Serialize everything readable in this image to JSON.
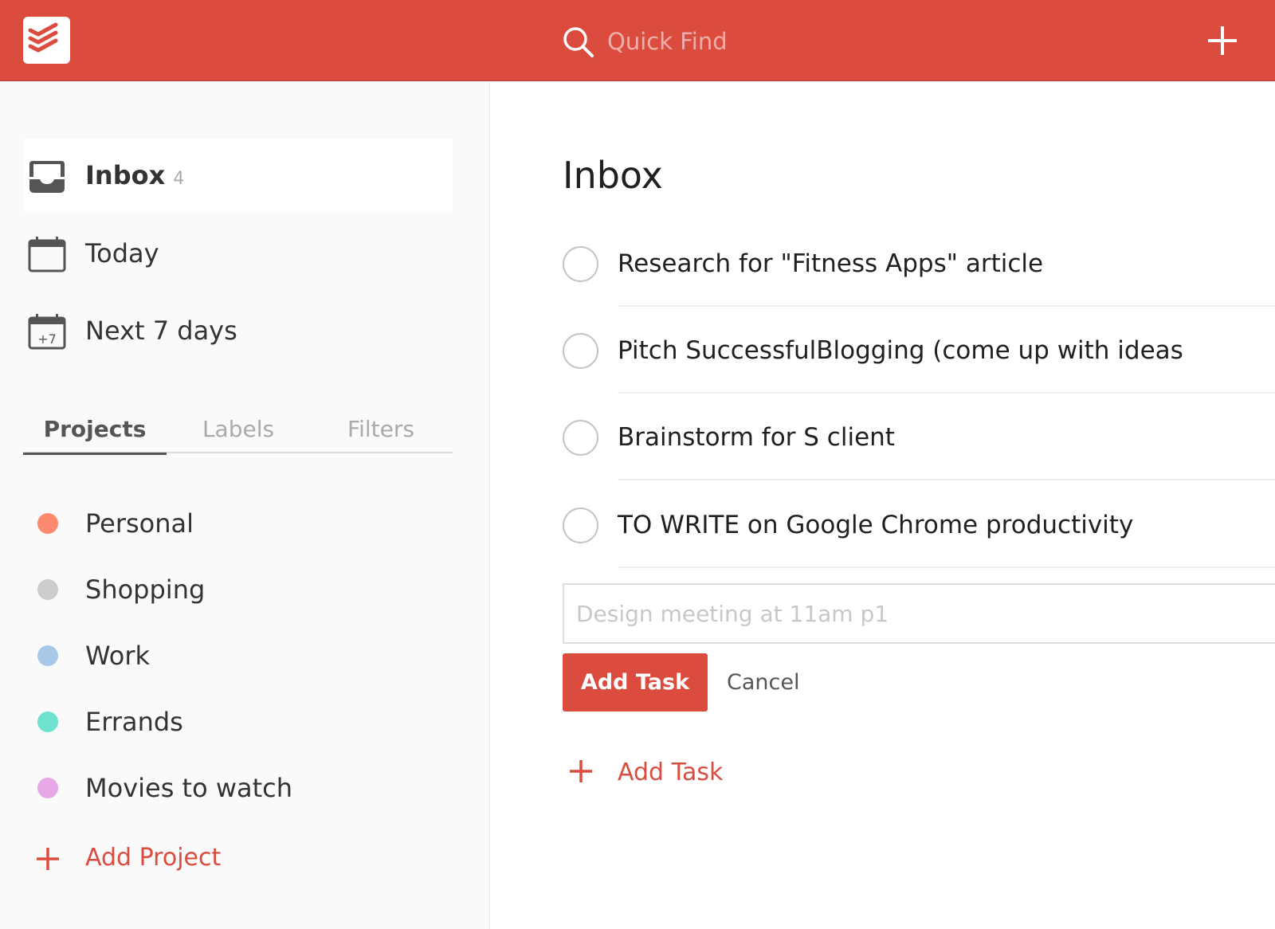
{
  "header": {
    "search_placeholder": "Quick Find",
    "brand_color": "#db4c3f",
    "icons": {
      "logo": "todoist-logo-icon",
      "search": "search-icon",
      "add": "plus-icon"
    }
  },
  "sidebar": {
    "nav": [
      {
        "label": "Inbox",
        "count": "4",
        "icon": "inbox-icon",
        "active": true
      },
      {
        "label": "Today",
        "icon": "calendar-icon"
      },
      {
        "label": "Next 7 days",
        "icon": "calendar-plus7-icon",
        "icon_text": "+7"
      }
    ],
    "tabs": [
      {
        "label": "Projects",
        "active": true
      },
      {
        "label": "Labels"
      },
      {
        "label": "Filters"
      }
    ],
    "projects": [
      {
        "label": "Personal",
        "color": "#fd8a6e"
      },
      {
        "label": "Shopping",
        "color": "#cccccc"
      },
      {
        "label": "Work",
        "color": "#a8c8e8"
      },
      {
        "label": "Errands",
        "color": "#6ee2cf"
      },
      {
        "label": "Movies to watch",
        "color": "#e6a8e6"
      }
    ],
    "add_project_label": "Add Project"
  },
  "main": {
    "title": "Inbox",
    "tasks": [
      {
        "text": "Research for \"Fitness Apps\" article"
      },
      {
        "text": "Pitch SuccessfulBlogging (come up with ideas"
      },
      {
        "text": "Brainstorm for S client"
      },
      {
        "text": "TO WRITE on Google Chrome productivity"
      }
    ],
    "new_task": {
      "value": "",
      "placeholder": "Design meeting at 11am p1",
      "add_button_label": "Add Task",
      "cancel_label": "Cancel"
    },
    "add_task_link_label": "Add Task"
  }
}
